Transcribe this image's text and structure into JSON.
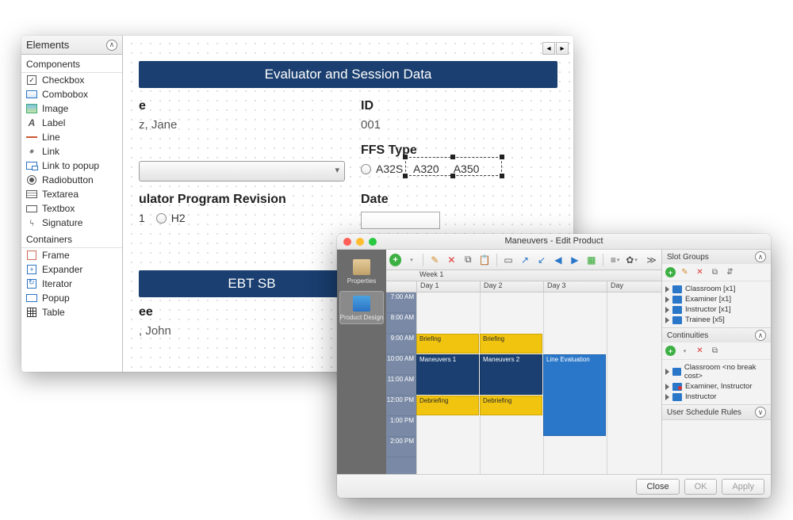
{
  "win1": {
    "palette": {
      "header": "Elements",
      "sections": {
        "components": {
          "title": "Components",
          "items": [
            "Checkbox",
            "Combobox",
            "Image",
            "Label",
            "Line",
            "Link",
            "Link to popup",
            "Radiobutton",
            "Textarea",
            "Textbox",
            "Signature"
          ]
        },
        "containers": {
          "title": "Containers",
          "items": [
            "Frame",
            "Expander",
            "Iterator",
            "Popup",
            "Table"
          ]
        }
      }
    },
    "form": {
      "section1_title": "Evaluator and Session Data",
      "name_label_partial": "e",
      "name_value_partial": "z, Jane",
      "id_label": "ID",
      "id_value": "001",
      "combo_label_partial": "",
      "ffs_label": "FFS Type",
      "ffs_options": [
        "A32S",
        "A320",
        "A350"
      ],
      "program_label_partial": "ulator Program Revision",
      "program_options": [
        "1",
        "H2"
      ],
      "date_label": "Date",
      "section2_title": "EBT SB",
      "trainee_label_partial": "ee",
      "trainee_value_partial": ", John"
    }
  },
  "win2": {
    "title": "Maneuvers - Edit Product",
    "nav": {
      "properties": "Properties",
      "product_design": "Product Design"
    },
    "timeline": {
      "week_label": "Week 1",
      "days": [
        "Day 1",
        "Day 2",
        "Day 3",
        "Day"
      ],
      "hours": [
        "7:00 AM",
        "8:00 AM",
        "9:00 AM",
        "10:00 AM",
        "11:00 AM",
        "12:00 PM",
        "1:00 PM",
        "2:00 PM"
      ],
      "events": [
        {
          "title": "Briefing",
          "day": 0,
          "start": 2,
          "len": 1,
          "type": "brief"
        },
        {
          "title": "Briefing",
          "day": 1,
          "start": 2,
          "len": 1,
          "type": "brief"
        },
        {
          "title": "Maneuvers 1",
          "day": 0,
          "start": 3,
          "len": 2,
          "type": "man"
        },
        {
          "title": "Maneuvers 2",
          "day": 1,
          "start": 3,
          "len": 2,
          "type": "man"
        },
        {
          "title": "Line Evaluation",
          "day": 2,
          "start": 3,
          "len": 4,
          "type": "line"
        },
        {
          "title": "Debriefing",
          "day": 0,
          "start": 5,
          "len": 1,
          "type": "debrief"
        },
        {
          "title": "Debriefing",
          "day": 1,
          "start": 5,
          "len": 1,
          "type": "debrief"
        }
      ]
    },
    "panels": {
      "slot_groups": {
        "title": "Slot Groups",
        "items": [
          "Classroom [x1]",
          "Examiner [x1]",
          "Instructor [x1]",
          "Trainee [x5]"
        ]
      },
      "continuities": {
        "title": "Continuities",
        "items": [
          "Classroom <no break cost>",
          "Examiner, Instructor",
          "Instructor"
        ]
      },
      "user_rules": {
        "title": "User Schedule Rules"
      }
    },
    "footer": {
      "close": "Close",
      "ok": "OK",
      "apply": "Apply"
    }
  }
}
